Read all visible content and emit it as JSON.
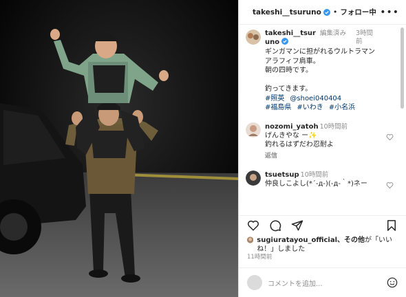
{
  "post": {
    "username": "takeshi__tsuruno",
    "follow_label": "フォロー中",
    "more_label": "•••"
  },
  "caption": {
    "username": "takeshi__tsuruno",
    "edited": "編集済み",
    "time": "3時間前",
    "text": "ギンガマンに担がれるウルトラマン\nアラフィフ肩車。\n朝の四時です。\n\n釣ってきます。",
    "tags_line1": [
      "#照英",
      "@shoei040404"
    ],
    "tags_line2": [
      "#福島県",
      "#いわき",
      "#小名浜"
    ]
  },
  "comments": [
    {
      "username": "nozomi_yatoh",
      "time": "10時間前",
      "text1": "げんきやな ー✨",
      "text2": "釣れるはずだわ忍耐よ",
      "reply": "返信"
    },
    {
      "username": "tsuetsup",
      "time": "10時間前",
      "text1": "仲良しこよし(*´-д-)(-д-｀*)ネー",
      "text2": "",
      "reply": ""
    }
  ],
  "likes": {
    "liker": "sugiuratayou_official",
    "suffix": "、その他",
    "end": "が「いいね！」しました"
  },
  "post_time": "11時間前",
  "add_comment": {
    "placeholder": "コメントを追加..."
  },
  "icons": {
    "heart": "heart-icon",
    "comment": "comment-icon",
    "share": "share-icon",
    "bookmark": "bookmark-icon",
    "emoji": "emoji-icon",
    "verified": "verified-icon"
  },
  "colors": {
    "link": "#00376b",
    "verified": "#3897f0",
    "muted": "#8e8e8e"
  }
}
